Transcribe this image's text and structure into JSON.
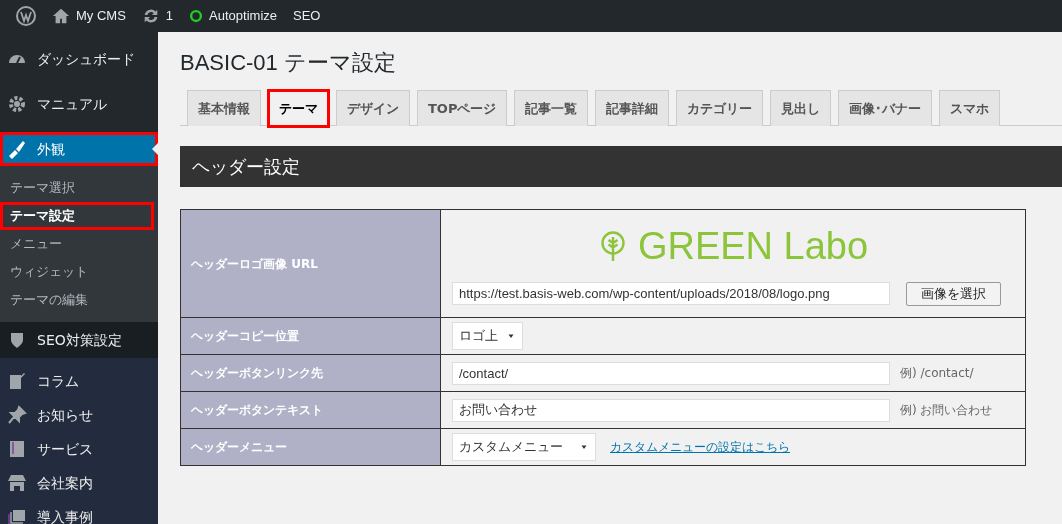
{
  "adminbar": {
    "site": "My CMS",
    "updates": "1",
    "items": [
      "Autoptimize",
      "SEO"
    ]
  },
  "sidebar": {
    "groups": [
      {
        "kind": "core",
        "items": [
          {
            "label": "ダッシュボード",
            "selected": false,
            "highlighted": false
          },
          {
            "label": "マニュアル",
            "selected": false,
            "highlighted": false
          },
          {
            "label": "外観",
            "selected": true,
            "highlighted": true,
            "children": [
              {
                "label": "テーマ選択",
                "selected": false,
                "highlighted": false
              },
              {
                "label": "テーマ設定",
                "selected": true,
                "highlighted": true
              },
              {
                "label": "メニュー",
                "selected": false,
                "highlighted": false
              },
              {
                "label": "ウィジェット",
                "selected": false,
                "highlighted": false
              },
              {
                "label": "テーマの編集",
                "selected": false,
                "highlighted": false
              }
            ]
          }
        ]
      },
      {
        "kind": "plugin",
        "items": [
          {
            "label": "SEO対策設定",
            "selected": false,
            "highlighted": false
          }
        ]
      },
      {
        "kind": "content",
        "items": [
          {
            "label": "コラム",
            "selected": false,
            "highlighted": false
          },
          {
            "label": "お知らせ",
            "selected": false,
            "highlighted": false
          },
          {
            "label": "サービス",
            "selected": false,
            "highlighted": false
          },
          {
            "label": "会社案内",
            "selected": false,
            "highlighted": false
          },
          {
            "label": "導入事例",
            "selected": false,
            "highlighted": false
          }
        ]
      }
    ]
  },
  "page": {
    "title": "BASIC-01 テーマ設定",
    "tabs": [
      {
        "label": "基本情報",
        "selected": false,
        "highlighted": false
      },
      {
        "label": "テーマ",
        "selected": true,
        "highlighted": true
      },
      {
        "label": "デザイン",
        "selected": false,
        "highlighted": false
      },
      {
        "label": "TOPページ",
        "selected": false,
        "highlighted": false
      },
      {
        "label": "記事一覧",
        "selected": false,
        "highlighted": false
      },
      {
        "label": "記事詳細",
        "selected": false,
        "highlighted": false
      },
      {
        "label": "カテゴリー",
        "selected": false,
        "highlighted": false
      },
      {
        "label": "見出し",
        "selected": false,
        "highlighted": false
      },
      {
        "label": "画像･バナー",
        "selected": false,
        "highlighted": false
      },
      {
        "label": "スマホ",
        "selected": false,
        "highlighted": false
      }
    ],
    "section": "ヘッダー設定",
    "rows": [
      {
        "label": "ヘッダーロゴ画像 URL",
        "kind": "image",
        "logo_text": "GREEN Labo",
        "value": "https://test.basis-web.com/wp-content/uploads/2018/08/logo.png",
        "button": "画像を選択"
      },
      {
        "label": "ヘッダーコピー位置",
        "kind": "select",
        "value": "ロゴ上"
      },
      {
        "label": "ヘッダーボタンリンク先",
        "kind": "text",
        "value": "/contact/",
        "example": "例) /contact/"
      },
      {
        "label": "ヘッダーボタンテキスト",
        "kind": "text",
        "value": "お問い合わせ",
        "example": "例) お問い合わせ"
      },
      {
        "label": "ヘッダーメニュー",
        "kind": "select",
        "value": "カスタムメニュー",
        "link": "カスタムメニューの設定はこちら"
      }
    ]
  }
}
